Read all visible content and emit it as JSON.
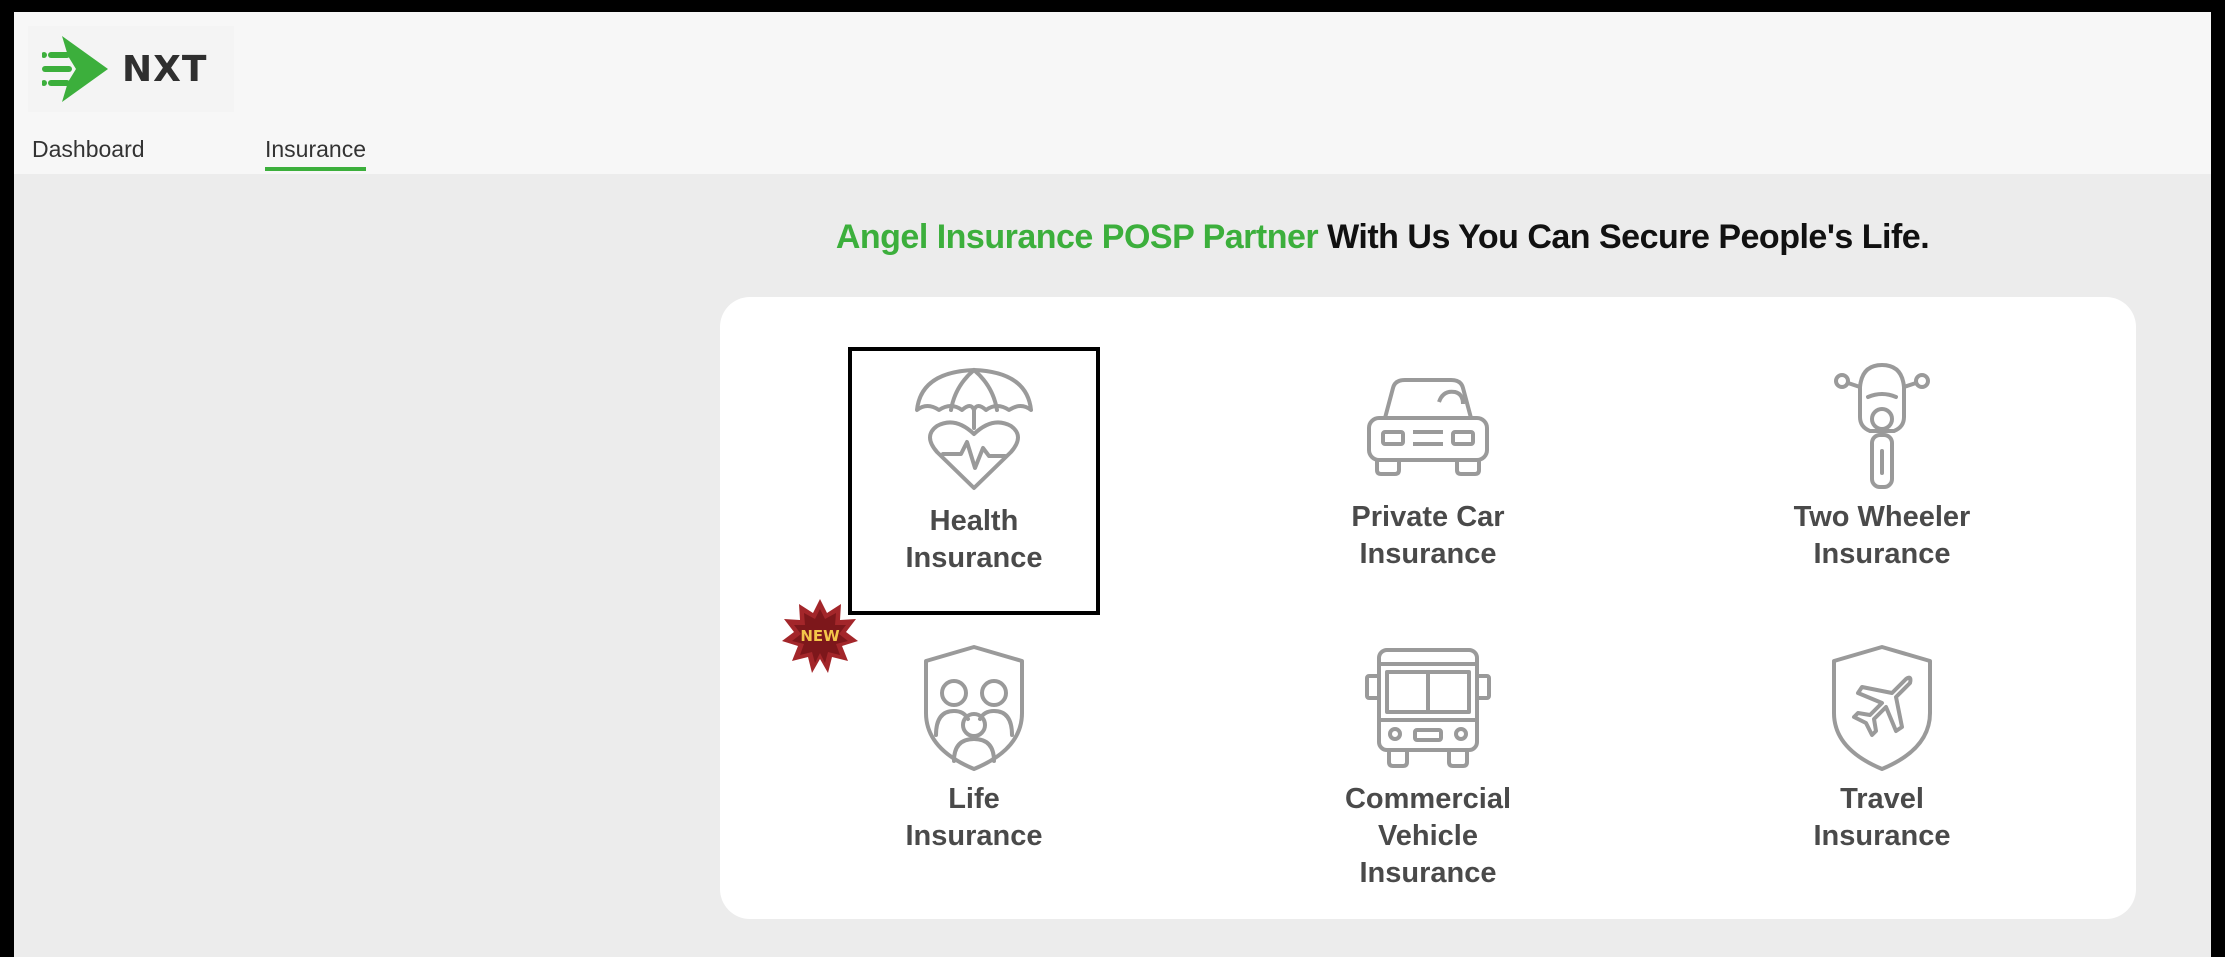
{
  "app": {
    "logo_text": "NXT",
    "accent_color": "#3caf3c"
  },
  "nav": {
    "items": [
      {
        "label": "Dashboard",
        "active": false
      },
      {
        "label": "Insurance",
        "active": true
      }
    ]
  },
  "headline": {
    "green_text": "Angel Insurance POSP Partner",
    "dark_text": "With Us You Can Secure People's Life."
  },
  "products": [
    {
      "line1": "Health",
      "line2": "Insurance",
      "icon": "umbrella-heart-icon",
      "selected": true
    },
    {
      "line1": "Private Car",
      "line2": "Insurance",
      "icon": "car-icon",
      "selected": false
    },
    {
      "line1": "Two Wheeler",
      "line2": "Insurance",
      "icon": "scooter-icon",
      "selected": false
    },
    {
      "line1": "Life",
      "line2": "Insurance",
      "icon": "family-shield-icon",
      "badge": "NEW",
      "selected": false
    },
    {
      "line1": "Commercial Vehicle",
      "line2": "Insurance",
      "icon": "bus-icon",
      "selected": false
    },
    {
      "line1": "Travel",
      "line2": "Insurance",
      "icon": "plane-shield-icon",
      "selected": false
    }
  ]
}
